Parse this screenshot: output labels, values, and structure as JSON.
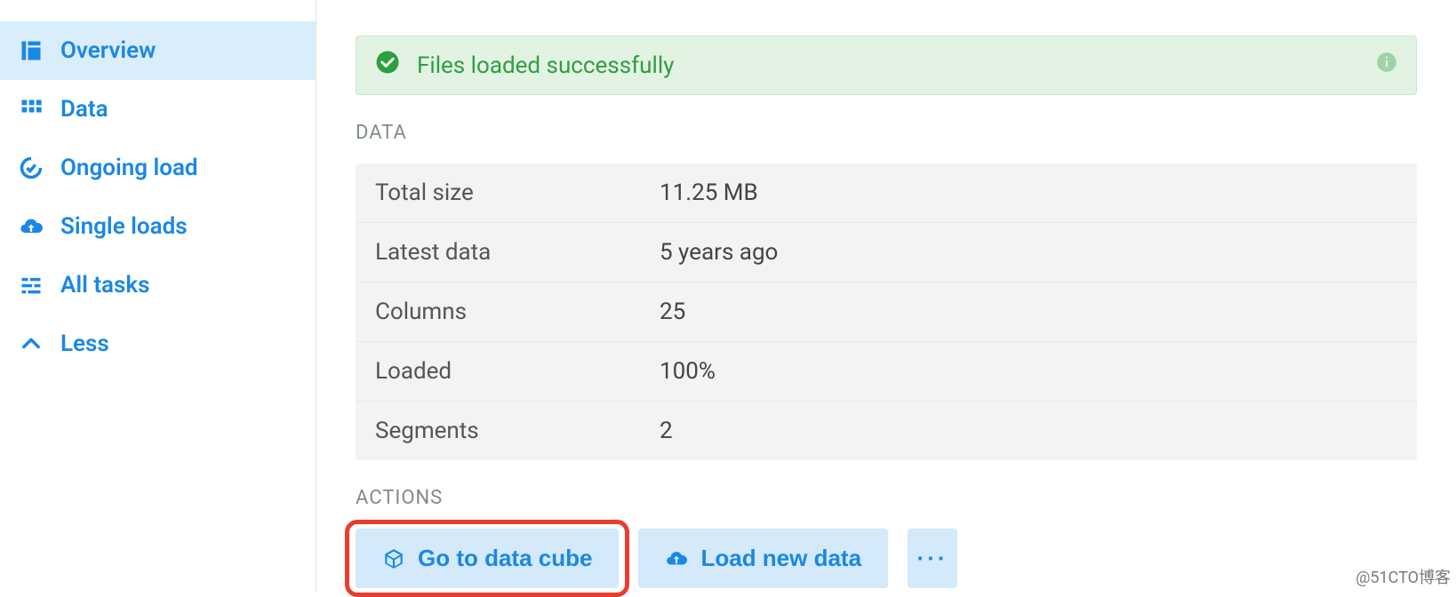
{
  "sidebar": {
    "items": [
      {
        "label": "Overview",
        "icon": "dashboard-icon",
        "active": true
      },
      {
        "label": "Data",
        "icon": "grid-icon",
        "active": false
      },
      {
        "label": "Ongoing load",
        "icon": "loading-icon",
        "active": false
      },
      {
        "label": "Single loads",
        "icon": "cloud-upload-icon",
        "active": false
      },
      {
        "label": "All tasks",
        "icon": "tasks-icon",
        "active": false
      },
      {
        "label": "Less",
        "icon": "chevron-up-icon",
        "active": false
      }
    ]
  },
  "alert": {
    "message": "Files loaded successfully"
  },
  "sections": {
    "data_label": "DATA",
    "actions_label": "ACTIONS"
  },
  "data_rows": [
    {
      "key": "Total size",
      "value": "11.25 MB"
    },
    {
      "key": "Latest data",
      "value": "5 years ago"
    },
    {
      "key": "Columns",
      "value": "25"
    },
    {
      "key": "Loaded",
      "value": "100%"
    },
    {
      "key": "Segments",
      "value": "2"
    }
  ],
  "actions": {
    "primary": {
      "label": "Go to data cube",
      "icon": "cube-icon"
    },
    "secondary": {
      "label": "Load new data",
      "icon": "cloud-upload-icon"
    },
    "more": {
      "label": "···"
    }
  },
  "watermark": "@51CTO博客",
  "highlight_target": "go-to-data-cube-button"
}
